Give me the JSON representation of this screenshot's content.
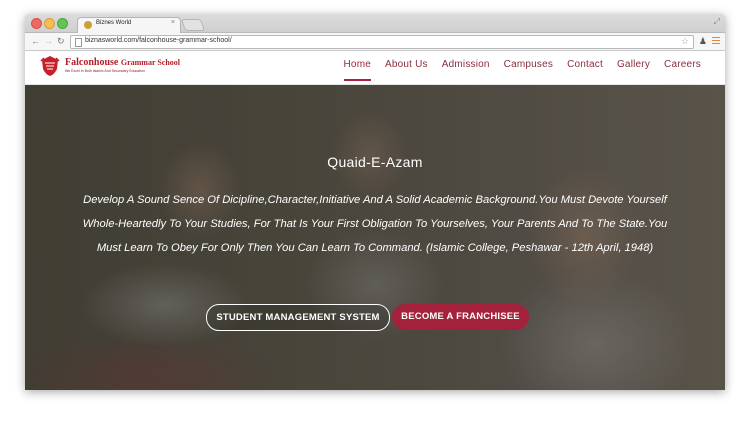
{
  "browser": {
    "tab_title": "Biznes World",
    "tab_close": "×",
    "url": "biznasworld.com/falconhouse-grammar-school/"
  },
  "site": {
    "logo_name": "Falconhouse",
    "logo_name_suffix": "Grammar School",
    "logo_tagline": "We Excel In Both Islamic And Secondary Education"
  },
  "nav": {
    "items": [
      {
        "label": "Home",
        "active": true
      },
      {
        "label": "About Us"
      },
      {
        "label": "Admission"
      },
      {
        "label": "Campuses"
      },
      {
        "label": "Contact"
      },
      {
        "label": "Gallery"
      },
      {
        "label": "Careers"
      }
    ]
  },
  "hero": {
    "title": "Quaid-E-Azam",
    "quote": "Develop A Sound Sence Of Dicipline,Character,Initiative And A Solid Academic Background.You Must Devote Yourself Whole-Heartedly To Your Studies, For That Is Your First Obligation To Yourselves, Your Parents And To The State.You Must Learn To Obey For Only Then You Can Learn To Command. (Islamic College, Peshawar - 12th April, 1948)",
    "btn_primary": "STUDENT MANAGEMENT SYSTEM",
    "btn_secondary": "BECOME A FRANCHISEE"
  },
  "colors": {
    "brand": "#a3213a",
    "nav_text": "#8a2e3c",
    "logo_red": "#b3202a"
  }
}
